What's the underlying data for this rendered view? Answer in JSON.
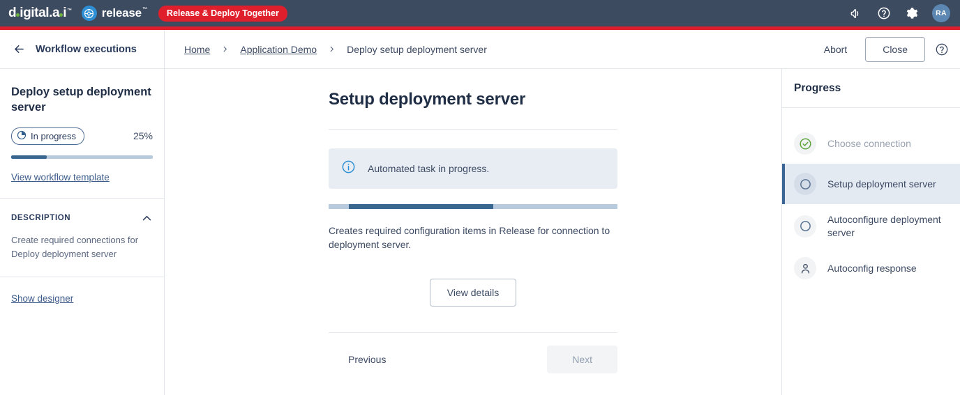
{
  "topbar": {
    "brand_primary": "digital.ai",
    "brand_primary_tm": "™",
    "brand_product": "release",
    "brand_product_tm": "™",
    "promo_pill": "Release & Deploy Together",
    "icons": [
      "announcement-icon",
      "help-circle-icon",
      "gear-icon"
    ],
    "avatar_initials": "RA",
    "bg_color": "#3d4b60",
    "accent_stripe_color": "#dd1f2d",
    "promo_color": "#e01f2d",
    "logo_dot_color": "#6cb33f",
    "release_badge_color": "#2e8fd4"
  },
  "subheader": {
    "back_label": "Workflow executions",
    "breadcrumb": [
      {
        "label": "Home",
        "link": true
      },
      {
        "label": "Application Demo",
        "link": true
      },
      {
        "label": "Deploy setup deployment server",
        "link": false
      }
    ],
    "separator": "›",
    "abort_label": "Abort",
    "close_label": "Close"
  },
  "left_panel": {
    "title": "Deploy setup deployment server",
    "status_label": "In progress",
    "status_icon": "pie-clock-icon",
    "percent_label": "25%",
    "percent_value": 25,
    "progress_fill_color": "#38668f",
    "progress_track_color": "#b8cadd",
    "view_template_link": "View workflow template",
    "description_heading": "DESCRIPTION",
    "description_text": "Create required connections for Deploy deployment server",
    "show_designer_link": "Show designer"
  },
  "main": {
    "title": "Setup deployment server",
    "alert_icon": "info-circle-icon",
    "alert_text": "Automated task in progress.",
    "indeterminate_bar": {
      "start_pct": 7,
      "width_pct": 50
    },
    "body_text": "Creates required configuration items in Release for connection to deployment server.",
    "view_details_label": "View details",
    "previous_label": "Previous",
    "next_label": "Next",
    "next_disabled": true
  },
  "right_panel": {
    "title": "Progress",
    "items": [
      {
        "label": "Choose connection",
        "icon": "check-circle-icon",
        "state": "done"
      },
      {
        "label": "Setup deployment server",
        "icon": "circle-outline-icon",
        "state": "active"
      },
      {
        "label": "Autoconfigure deployment server",
        "icon": "circle-outline-icon",
        "state": "pending"
      },
      {
        "label": "Autoconfig response",
        "icon": "person-icon",
        "state": "pending"
      }
    ],
    "active_accent_color": "#3a6594",
    "done_icon_color": "#5ea53c"
  }
}
